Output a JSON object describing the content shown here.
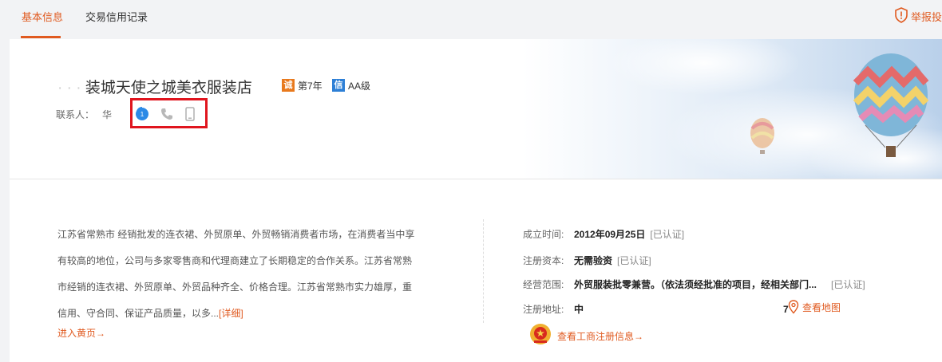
{
  "tabs": [
    {
      "label": "基本信息"
    },
    {
      "label": "交易信用记录"
    }
  ],
  "report": {
    "label": "举报投"
  },
  "shop": {
    "name_masked": "· · ·",
    "name": "装城天使之城美衣服装店",
    "years_badge": "第7年",
    "credit_badge": "AA级",
    "years_icon": "诚",
    "credit_icon": "信"
  },
  "contact": {
    "label": "联系人：",
    "name": "华",
    "icons": [
      "wangwang-chat-icon",
      "phone-icon",
      "mobile-icon"
    ]
  },
  "description": {
    "text": "江苏省常熟市 经销批发的连衣裙、外贸原单、外贸畅销消费者市场，在消费者当中享有较高的地位，公司与多家零售商和代理商建立了长期稳定的合作关系。江苏省常熟市经销的连衣裙、外贸原单、外贸品种齐全、价格合理。江苏省常熟市实力雄厚，重信用、守合同、保证产品质量，以多...",
    "more": "[详细]",
    "enter": "进入黄页→"
  },
  "company_info": {
    "established_label": "成立时间:",
    "established_value": "2012年09月25日",
    "established_tag": "[已认证]",
    "capital_label": "注册资本:",
    "capital_value": "无需验资",
    "capital_tag": "[已认证]",
    "scope_label": "经营范围:",
    "scope_value": "外贸服装批零兼营。（依法须经批准的项目，经相关部门...",
    "scope_tag": "[已认证]",
    "address_label": "注册地址:",
    "address_value": "中",
    "address_tail": "7",
    "map_link": "查看地图",
    "reg_link": "查看工商注册信息→"
  },
  "colors": {
    "accent": "#e05a20",
    "highlight_box": "#e0151e",
    "badge_orange": "#e8791d",
    "badge_blue": "#2d7fd6"
  }
}
